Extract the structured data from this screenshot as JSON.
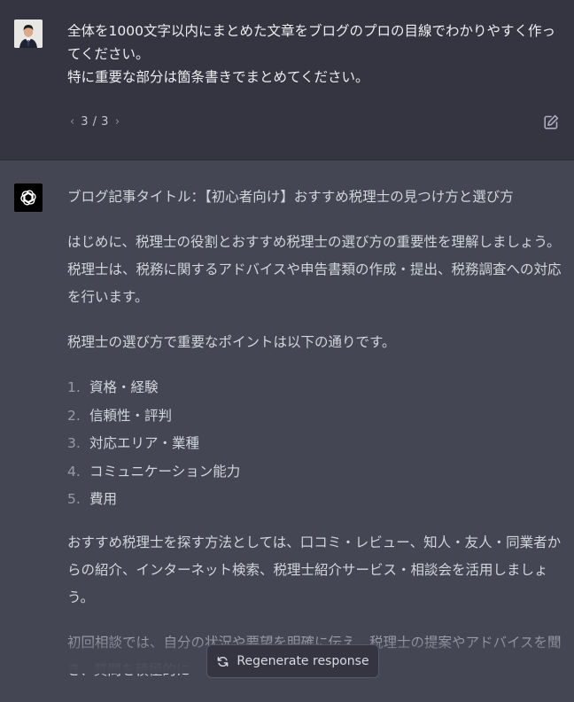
{
  "user_message": {
    "text": "全体を1000文字以内にまとめた文章をブログのプロの目線でわかりやすく作ってください。\n特に重要な部分は箇条書きでまとめてください。",
    "pager": "3 / 3",
    "prev_icon": "chevron-left-icon",
    "next_icon": "chevron-right-icon",
    "edit_icon": "edit-icon"
  },
  "assistant_message": {
    "title": "ブログ記事タイトル：【初心者向け】おすすめ税理士の見つけ方と選び方",
    "intro": "はじめに、税理士の役割とおすすめ税理士の選び方の重要性を理解しましょう。税理士は、税務に関するアドバイスや申告書類の作成・提出、税務調査への対応を行います。",
    "points_intro": "税理士の選び方で重要なポイントは以下の通りです。",
    "points": [
      {
        "num": "1.",
        "label": "資格・経験"
      },
      {
        "num": "2.",
        "label": "信頼性・評判"
      },
      {
        "num": "3.",
        "label": "対応エリア・業種"
      },
      {
        "num": "4.",
        "label": "コミュニケーション能力"
      },
      {
        "num": "5.",
        "label": "費用"
      }
    ],
    "search": "おすすめ税理士を探す方法としては、口コミ・レビュー、知人・友人・同業者からの紹介、インターネット検索、税理士紹介サービス・相談会を活用しましょう。",
    "consult": "初回相談では、自分の状況や要望を明確に伝え、税理士の提案やアドバイスを聞き、質問を積極的に"
  },
  "regenerate": {
    "label": "Regenerate response",
    "icon": "refresh-icon"
  },
  "colors": {
    "user_bg": "#343541",
    "assistant_bg": "#444654",
    "text": "#ececf1"
  }
}
